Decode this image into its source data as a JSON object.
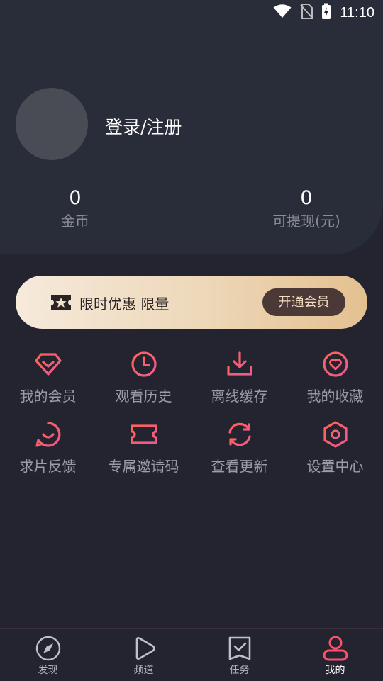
{
  "status_bar": {
    "time": "11:10"
  },
  "profile": {
    "login_label": "登录/注册"
  },
  "stats": [
    {
      "value": "0",
      "label": "金币"
    },
    {
      "value": "0",
      "label": "可提现(元)"
    }
  ],
  "vip_banner": {
    "text": "限时优惠 限量",
    "button_label": "开通会员"
  },
  "menu": [
    {
      "label": "我的会员",
      "icon": "diamond-icon"
    },
    {
      "label": "观看历史",
      "icon": "clock-icon"
    },
    {
      "label": "离线缓存",
      "icon": "download-icon"
    },
    {
      "label": "我的收藏",
      "icon": "heart-icon"
    },
    {
      "label": "求片反馈",
      "icon": "feedback-chat-icon"
    },
    {
      "label": "专属邀请码",
      "icon": "ticket-icon"
    },
    {
      "label": "查看更新",
      "icon": "refresh-icon"
    },
    {
      "label": "设置中心",
      "icon": "settings-icon"
    }
  ],
  "bottom_nav": [
    {
      "label": "发现",
      "icon": "compass-icon",
      "active": false
    },
    {
      "label": "频道",
      "icon": "play-icon",
      "active": false
    },
    {
      "label": "任务",
      "icon": "task-icon",
      "active": false
    },
    {
      "label": "我的",
      "icon": "user-icon",
      "active": true
    }
  ],
  "colors": {
    "background": "#23242f",
    "header": "#292c39",
    "accent_gradient_start": "#ff5a62",
    "accent_gradient_end": "#ee5f8c",
    "vip_gold": "#e3c08f"
  }
}
